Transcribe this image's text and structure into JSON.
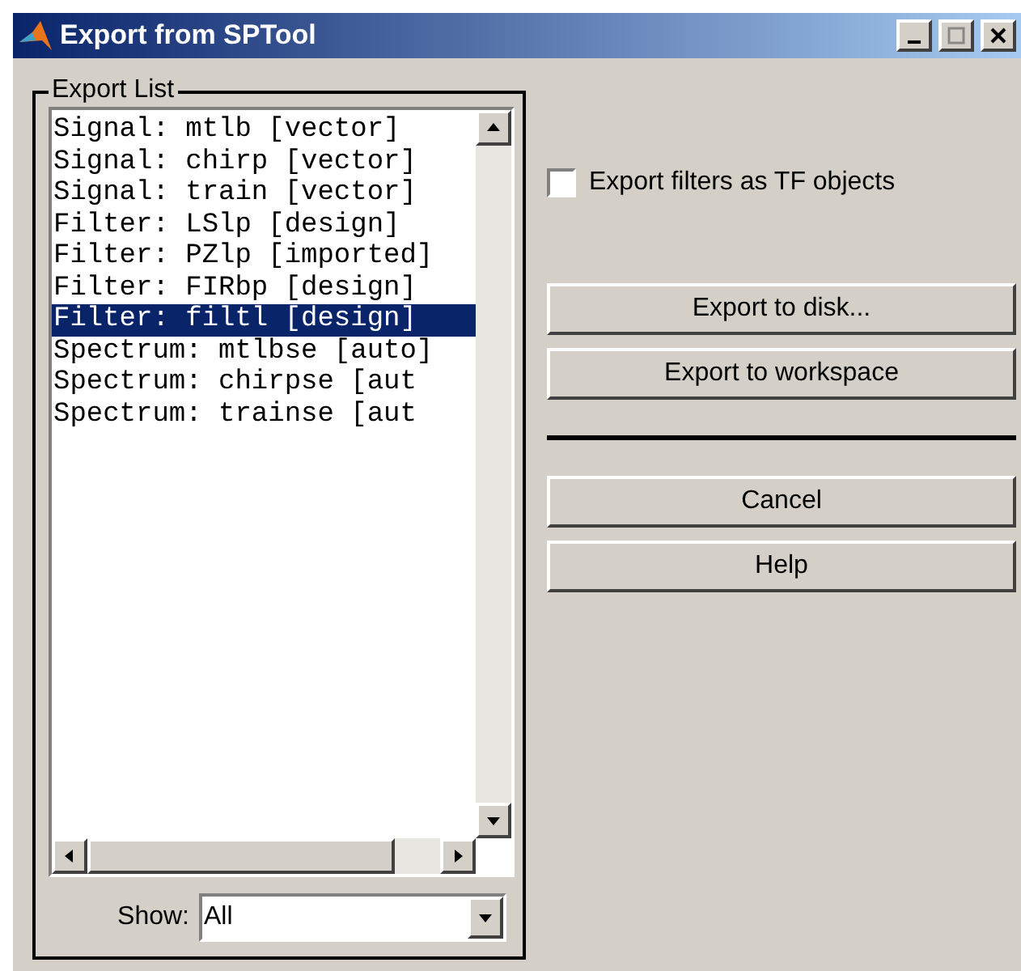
{
  "window": {
    "title": "Export from SPTool"
  },
  "export_list": {
    "label": "Export List",
    "items": [
      {
        "label": "Signal: mtlb [vector]",
        "selected": false
      },
      {
        "label": "Signal: chirp [vector]",
        "selected": false
      },
      {
        "label": "Signal: train [vector]",
        "selected": false
      },
      {
        "label": "Filter: LSlp [design]",
        "selected": false
      },
      {
        "label": "Filter: PZlp [imported]",
        "selected": false
      },
      {
        "label": "Filter: FIRbp [design]",
        "selected": false
      },
      {
        "label": "Filter: filtl [design]",
        "selected": true
      },
      {
        "label": "Spectrum: mtlbse [auto]",
        "selected": false
      },
      {
        "label": "Spectrum: chirpse [aut",
        "selected": false
      },
      {
        "label": "Spectrum: trainse [aut",
        "selected": false
      }
    ],
    "show": {
      "label": "Show:",
      "value": "All"
    }
  },
  "export_filters_checkbox": {
    "label": "Export filters as TF objects",
    "checked": false
  },
  "buttons": [
    "Export to disk...",
    "Export to workspace"
  ],
  "buttons_bottom": [
    "Cancel",
    "Help"
  ]
}
